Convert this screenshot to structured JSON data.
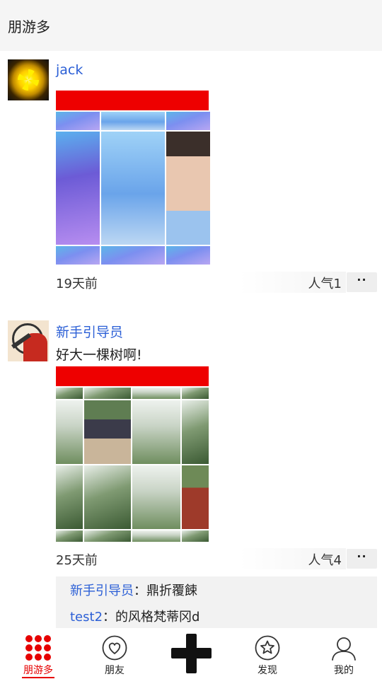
{
  "header": {
    "title": "朋游多"
  },
  "posts": [
    {
      "username": "jack",
      "caption": "",
      "time": "19天前",
      "popularity": "人气1",
      "more_label": "··",
      "comments": []
    },
    {
      "username": "新手引导员",
      "caption": "好大一棵树啊!",
      "time": "25天前",
      "popularity": "人气4",
      "more_label": "··",
      "comments": [
        {
          "name": "新手引导员",
          "sep": "：",
          "text": "鼎折覆餗"
        },
        {
          "name": "test2",
          "sep": "：",
          "text": "的风格梵蒂冈d"
        }
      ]
    }
  ],
  "tabbar": {
    "home": "朋游多",
    "friends": "朋友",
    "discover": "发现",
    "mine": "我的"
  },
  "colors": {
    "accent": "#e60000",
    "link": "#2b5fd6",
    "banner": "#ee0000"
  },
  "icons": {
    "home": "grid-dots-icon",
    "friends": "heart-circle-icon",
    "add": "plus-icon",
    "discover": "star-circle-icon",
    "mine": "user-icon"
  }
}
